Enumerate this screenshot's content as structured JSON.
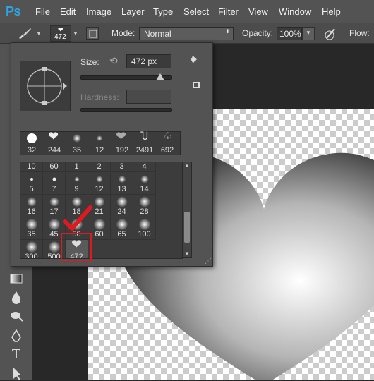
{
  "app": {
    "logo": "Ps"
  },
  "menu": [
    "File",
    "Edit",
    "Image",
    "Layer",
    "Type",
    "Select",
    "Filter",
    "View",
    "Window",
    "Help"
  ],
  "options": {
    "brush_size": "472",
    "mode_label": "Mode:",
    "mode_value": "Normal",
    "opacity_label": "Opacity:",
    "opacity_value": "100%",
    "flow_label": "Flow:"
  },
  "picker": {
    "size_label": "Size:",
    "size_value": "472 px",
    "hardness_label": "Hardness:",
    "presets_top": [
      "32",
      "244",
      "35",
      "12",
      "192",
      "2491",
      "692"
    ],
    "grid_row0": [
      "10",
      "60",
      "1",
      "2",
      "3",
      "4"
    ],
    "grid_rows": [
      [
        "5",
        "7",
        "9",
        "12",
        "13",
        "14"
      ],
      [
        "16",
        "17",
        "18",
        "21",
        "24",
        "28"
      ],
      [
        "35",
        "45",
        "50",
        "60",
        "65",
        "100"
      ],
      [
        "300",
        "500",
        "472"
      ]
    ]
  },
  "colors": {
    "accent_red": "#e0191f",
    "ps_blue": "#2fa3e6"
  }
}
